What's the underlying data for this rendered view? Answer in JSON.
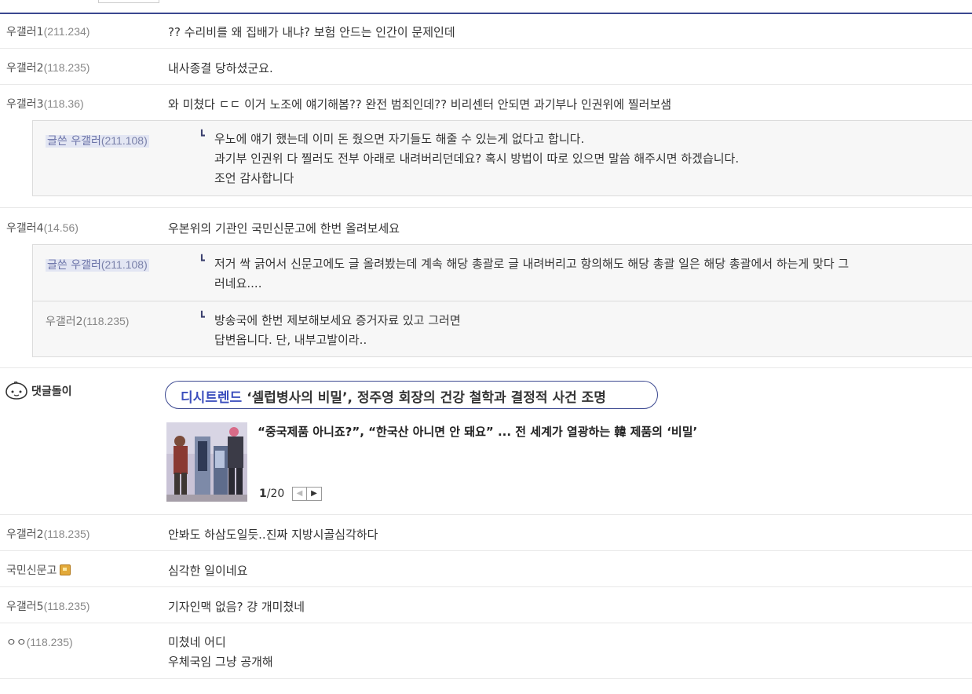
{
  "comments": [
    {
      "nick": "우갤러1",
      "ip": "(211.234)",
      "text": "?? 수리비를 왜 집배가 내냐? 보험 안드는 인간이 문제인데"
    },
    {
      "nick": "우갤러2",
      "ip": "(118.235)",
      "text": "내사종결 당하셨군요."
    },
    {
      "nick": "우갤러3",
      "ip": "(118.36)",
      "text": "와 미쳤다 ㄷㄷ 이거 노조에 얘기해봄?? 완전 범죄인데?? 비리센터 안되면 과기부나 인권위에 찔러보샘"
    },
    {
      "nick": "우갤러4",
      "ip": "(14.56)",
      "text": "우본위의 기관인 국민신문고에 한번 올려보세요"
    },
    {
      "nick": "우갤러2",
      "ip": "(118.235)",
      "text": "안봐도 하삼도일듯..진짜 지방시골심각하다"
    },
    {
      "nick": "국민신문고",
      "ip": "",
      "text": "심각한 일이네요"
    },
    {
      "nick": "우갤러5",
      "ip": "(118.235)",
      "text": "기자인맥 없음? 걍 개미쳤네"
    },
    {
      "nick": "ㅇㅇ",
      "ip": "(118.235)",
      "line1": "미쳤네 어디",
      "line2": "우체국임 그냥 공개해"
    }
  ],
  "replies_a": [
    {
      "nick": "글쓴 우갤러",
      "ip": "(211.108)",
      "line1": "우노에 얘기 했는데 이미 돈 줬으면 자기들도 해줄 수 있는게 없다고 합니다.",
      "line2": "과기부 인권위 다 찔러도 전부 아래로 내려버리던데요? 혹시 방법이 따로 있으면 말씀 해주시면 하겠습니다.",
      "line3": "조언 감사합니다"
    }
  ],
  "replies_b": [
    {
      "nick": "글쓴 우갤러",
      "ip": "(211.108)",
      "line1": "저거 싹 긁어서 신문고에도 글 올려봤는데 계속 해당 총괄로 글 내려버리고 항의해도 해당 총괄 일은 해당 총괄에서 하는게 맞다 그",
      "line2": "러네요...."
    },
    {
      "nick": "우갤러2",
      "ip": "(118.235)",
      "line1": "방송국에 한번 제보해보세요 증거자료 있고 그러면",
      "line2": "답변옵니다. 단, 내부고발이라.."
    }
  ],
  "bot": {
    "label": "댓글돌이",
    "brand": "디시트렌드",
    "headline": "‘셀럽병사의 비밀’, 정주영 회장의 건강 철학과 결정적 사건 조명",
    "news_title": "“중국제품 아니죠?”, “한국산 아니면 안 돼요” ... 전 세계가 열광하는 韓 제품의 ‘비밀’",
    "page_current": "1",
    "page_total": "/20",
    "prev_icon": "chevron-left-icon",
    "next_icon": "chevron-right-icon"
  },
  "colors": {
    "accent": "#3b4890",
    "brand_text": "#3b4ebd",
    "writer_bg": "#e3e6f3"
  }
}
